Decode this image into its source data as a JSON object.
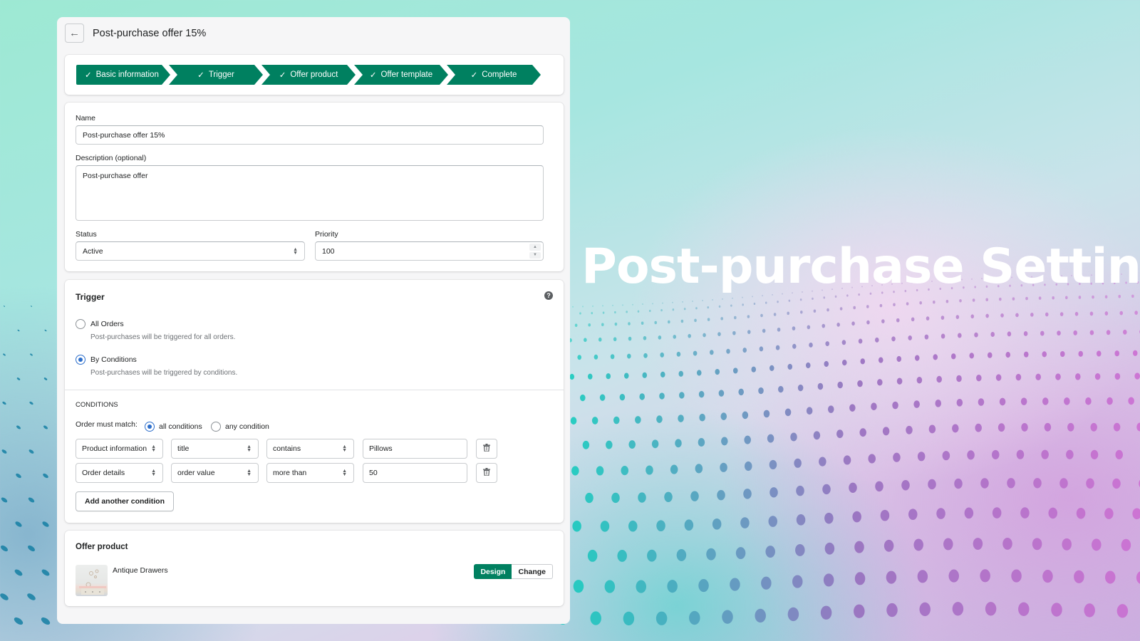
{
  "header": {
    "back_icon": "arrow-left-icon",
    "title": "Post-purchase offer 15%"
  },
  "steps": [
    {
      "label": "Basic information",
      "done": true
    },
    {
      "label": "Trigger",
      "done": true
    },
    {
      "label": "Offer product",
      "done": true
    },
    {
      "label": "Offer template",
      "done": true
    },
    {
      "label": "Complete",
      "done": true
    }
  ],
  "step_check": "✓",
  "basic": {
    "name_label": "Name",
    "name_value": "Post-purchase offer 15%",
    "description_label": "Description (optional)",
    "description_value": "Post-purchase offer",
    "status_label": "Status",
    "status_value": "Active",
    "priority_label": "Priority",
    "priority_value": "100"
  },
  "trigger": {
    "title": "Trigger",
    "help_icon": "question-circle-icon",
    "options": [
      {
        "label": "All Orders",
        "help": "Post-purchases will be triggered for all orders.",
        "checked": false
      },
      {
        "label": "By Conditions",
        "help": "Post-purchases will be triggered by conditions.",
        "checked": true
      }
    ],
    "conditions_heading": "CONDITIONS",
    "match_label": "Order must match:",
    "match_options": [
      {
        "label": "all conditions",
        "checked": true
      },
      {
        "label": "any condition",
        "checked": false
      }
    ],
    "conditions": [
      {
        "category": "Product information",
        "field": "title",
        "operator": "contains",
        "value": "Pillows"
      },
      {
        "category": "Order details",
        "field": "order value",
        "operator": "more than",
        "value": "50"
      }
    ],
    "add_condition_label": "Add another condition"
  },
  "offer_product": {
    "title": "Offer product",
    "product_name": "Antique Drawers",
    "design_label": "Design",
    "change_label": "Change"
  },
  "hero": {
    "title": "Post-purchase Setting"
  },
  "colors": {
    "primary": "#008060",
    "radio_accent": "#2c6ecb"
  }
}
